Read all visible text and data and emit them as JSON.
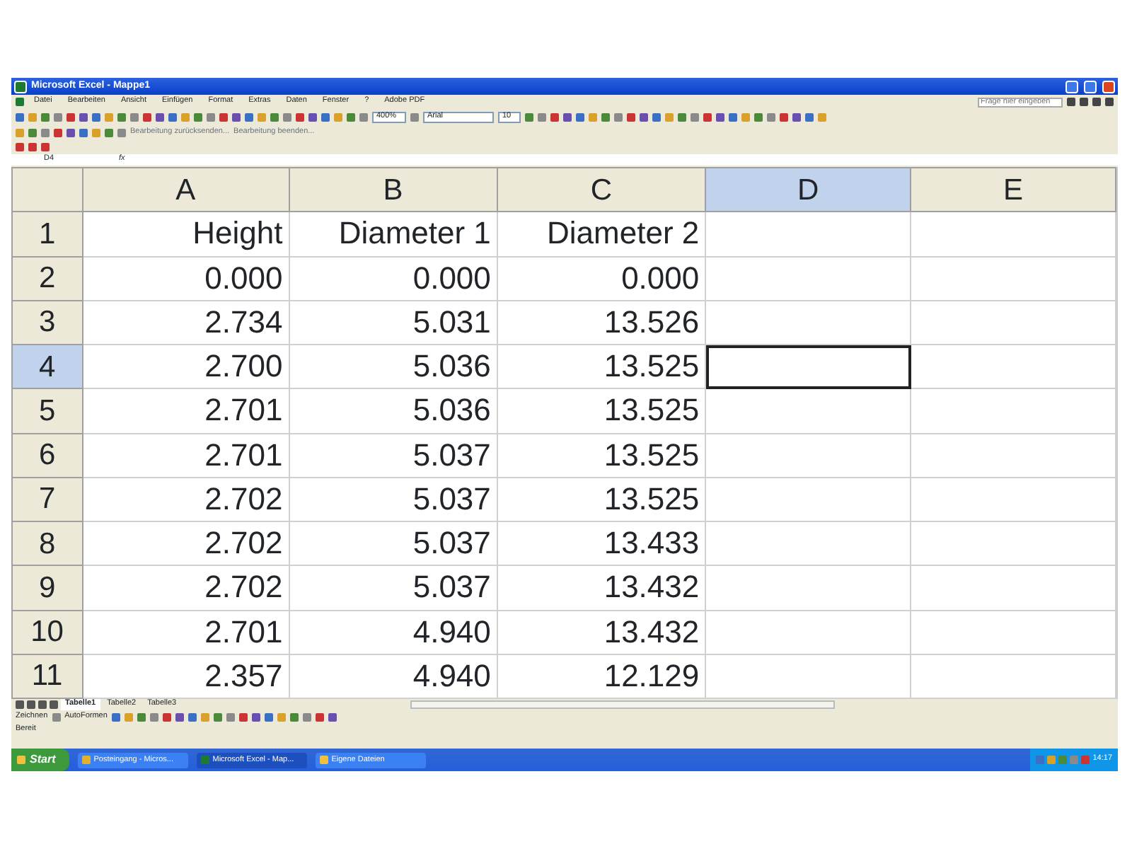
{
  "window": {
    "title": "Microsoft Excel - Mappe1"
  },
  "menu": [
    "Datei",
    "Bearbeiten",
    "Ansicht",
    "Einfügen",
    "Format",
    "Extras",
    "Daten",
    "Fenster",
    "?",
    "Adobe PDF"
  ],
  "help_box": {
    "placeholder": "Frage hier eingeben"
  },
  "toolbar": {
    "zoom": "400%",
    "font": "Arial",
    "font_size": "10"
  },
  "review_toolbar": {
    "reply": "Bearbeitung zurücksenden...",
    "end": "Bearbeitung beenden..."
  },
  "name_box": "D4",
  "formula_label": "fx",
  "grid": {
    "columns": [
      {
        "label": "A",
        "selected": false
      },
      {
        "label": "B",
        "selected": false
      },
      {
        "label": "C",
        "selected": false
      },
      {
        "label": "D",
        "selected": true
      },
      {
        "label": "E",
        "selected": false
      }
    ],
    "rows": [
      {
        "label": "1",
        "selected": false,
        "cells": [
          "Height",
          "Diameter 1",
          "Diameter 2"
        ]
      },
      {
        "label": "2",
        "selected": false,
        "cells": [
          "0.000",
          "0.000",
          "0.000"
        ]
      },
      {
        "label": "3",
        "selected": false,
        "cells": [
          "2.734",
          "5.031",
          "13.526"
        ]
      },
      {
        "label": "4",
        "selected": true,
        "cells": [
          "2.700",
          "5.036",
          "13.525"
        ]
      },
      {
        "label": "5",
        "selected": false,
        "cells": [
          "2.701",
          "5.036",
          "13.525"
        ]
      },
      {
        "label": "6",
        "selected": false,
        "cells": [
          "2.701",
          "5.037",
          "13.525"
        ]
      },
      {
        "label": "7",
        "selected": false,
        "cells": [
          "2.702",
          "5.037",
          "13.525"
        ]
      },
      {
        "label": "8",
        "selected": false,
        "cells": [
          "2.702",
          "5.037",
          "13.433"
        ]
      },
      {
        "label": "9",
        "selected": false,
        "cells": [
          "2.702",
          "5.037",
          "13.432"
        ]
      },
      {
        "label": "10",
        "selected": false,
        "cells": [
          "2.701",
          "4.940",
          "13.432"
        ]
      },
      {
        "label": "11",
        "selected": false,
        "cells": [
          "2.357",
          "4.940",
          "12.129"
        ]
      }
    ]
  },
  "sheet_tabs": [
    {
      "label": "Tabelle1",
      "selected": true
    },
    {
      "label": "Tabelle2",
      "selected": false
    },
    {
      "label": "Tabelle3",
      "selected": false
    }
  ],
  "drawing_toolbar": {
    "draw": "Zeichnen",
    "autoshapes": "AutoFormen"
  },
  "status_bar": "Bereit",
  "taskbar": {
    "start": "Start",
    "tasks": [
      {
        "label": "Posteingang - Micros...",
        "selected": false
      },
      {
        "label": "Microsoft Excel - Map...",
        "selected": true
      },
      {
        "label": "Eigene Dateien",
        "selected": false
      }
    ],
    "clock": "14:17"
  }
}
